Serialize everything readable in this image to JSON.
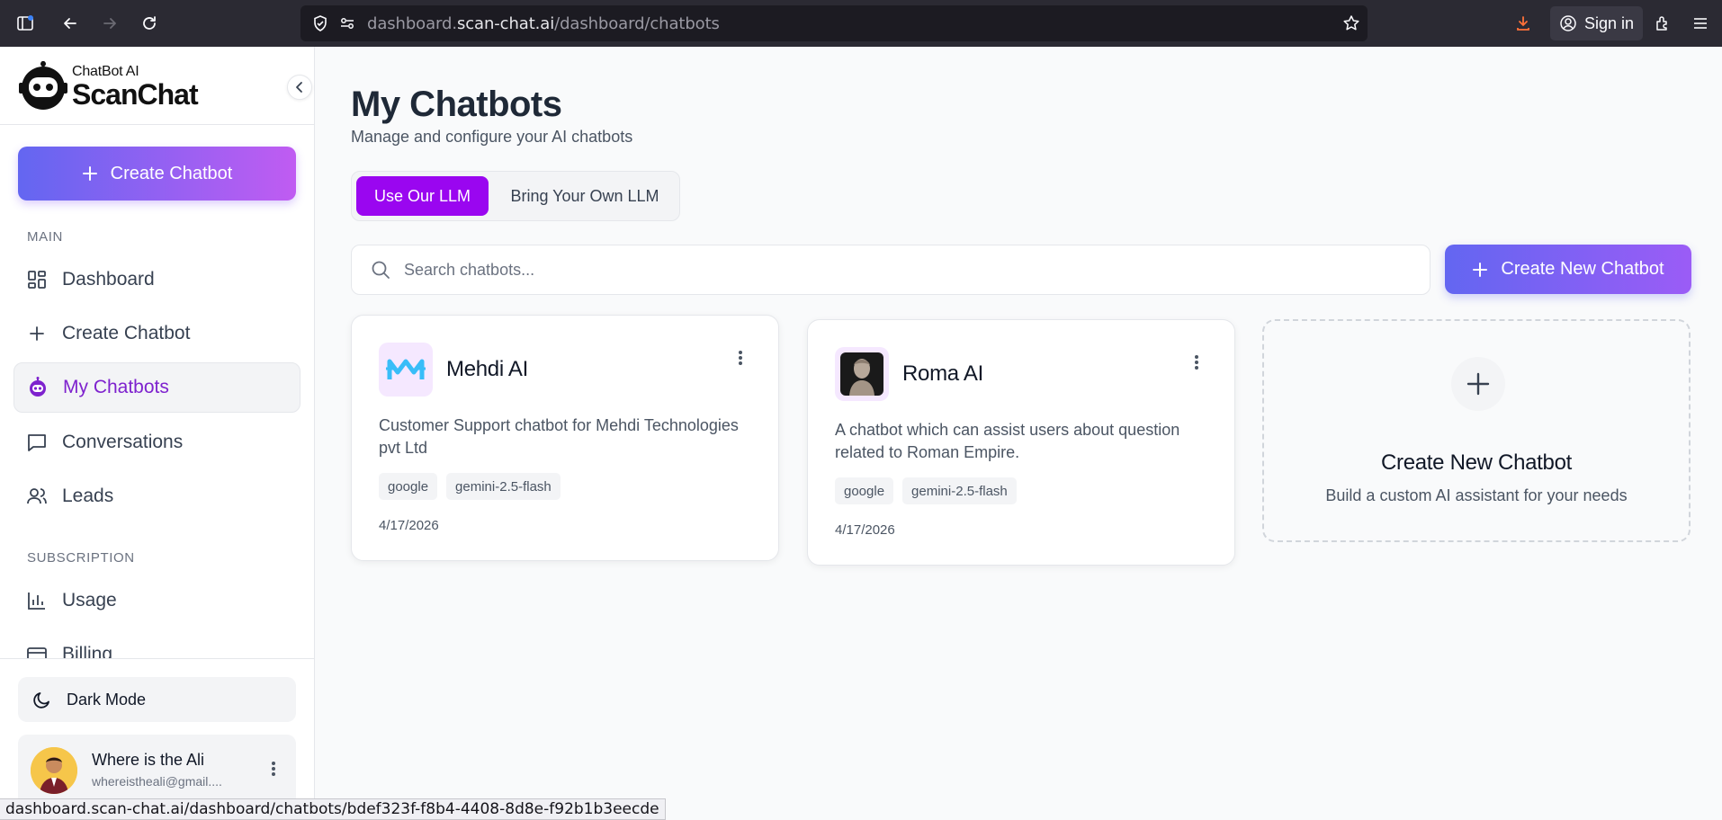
{
  "browser": {
    "url_prefix": "dashboard.",
    "url_host": "scan-chat.ai",
    "url_path": "/dashboard/chatbots",
    "sign_in": "Sign in",
    "status_url": "dashboard.scan-chat.ai/dashboard/chatbots/bdef323f-f8b4-4408-8d8e-f92b1b3eecde"
  },
  "sidebar": {
    "logo_small": "ChatBot AI",
    "logo_big": "ScanChat",
    "create_button": "Create Chatbot",
    "section_main": "MAIN",
    "section_subscription": "SUBSCRIPTION",
    "items": [
      {
        "label": "Dashboard",
        "icon": "dashboard-icon"
      },
      {
        "label": "Create Chatbot",
        "icon": "plus-icon"
      },
      {
        "label": "My Chatbots",
        "icon": "bot-icon",
        "active": true
      },
      {
        "label": "Conversations",
        "icon": "message-icon"
      },
      {
        "label": "Leads",
        "icon": "users-icon"
      },
      {
        "label": "Usage",
        "icon": "bar-chart-icon"
      },
      {
        "label": "Billing",
        "icon": "credit-card-icon"
      }
    ],
    "dark_mode": "Dark Mode",
    "user": {
      "name": "Where is the Ali",
      "email": "whereistheali@gmail...."
    }
  },
  "main": {
    "title": "My Chatbots",
    "subtitle": "Manage and configure your AI chatbots",
    "toggle": {
      "option_1": "Use Our LLM",
      "option_2": "Bring Your Own LLM",
      "selected": "Use Our LLM"
    },
    "search_placeholder": "Search chatbots...",
    "new_button": "Create New Chatbot",
    "chatbots": [
      {
        "name": "Mehdi AI",
        "description": "Customer Support chatbot for Mehdi Technologies pvt Ltd",
        "tags": [
          "google",
          "gemini-2.5-flash"
        ],
        "date": "4/17/2026"
      },
      {
        "name": "Roma AI",
        "description": "A chatbot which can assist users about question related to Roman Empire.",
        "tags": [
          "google",
          "gemini-2.5-flash"
        ],
        "date": "4/17/2026"
      }
    ],
    "new_card": {
      "title": "Create New Chatbot",
      "subtitle": "Build a custom AI assistant for your needs"
    }
  },
  "colors": {
    "accent_purple": "#9a06f0",
    "active_text": "#7e22ce",
    "gradient_start": "#6366f1",
    "gradient_end": "#c05cf2"
  }
}
